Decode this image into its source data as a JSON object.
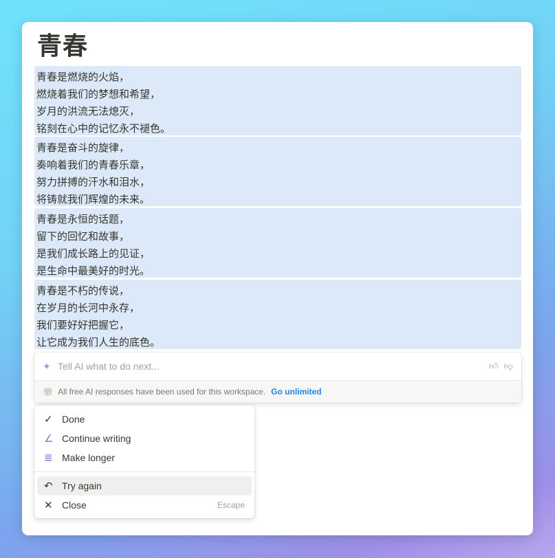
{
  "page": {
    "title": "青春"
  },
  "stanzas": [
    [
      "青春是燃烧的火焰，",
      "燃烧着我们的梦想和希望，",
      "岁月的洪流无法熄灭，",
      "铭刻在心中的记忆永不褪色。"
    ],
    [
      "青春是奋斗的旋律，",
      "奏响着我们的青春乐章，",
      "努力拼搏的汗水和泪水，",
      "将铸就我们辉煌的未来。"
    ],
    [
      "青春是永恒的话题，",
      "留下的回忆和故事，",
      "是我们成长路上的见证，",
      "是生命中最美好的时光。"
    ],
    [
      "青春是不朽的传说，",
      "在岁月的长河中永存，",
      "我们要好好把握它，",
      "让它成为我们人生的底色。"
    ]
  ],
  "ai_bar": {
    "placeholder": "Tell AI what to do next...",
    "notice": "All free AI responses have been used for this workspace.",
    "link": "Go unlimited",
    "link_color": "#2383e2"
  },
  "menu": {
    "items": [
      {
        "label": "Done",
        "icon": "check-icon"
      },
      {
        "label": "Continue writing",
        "icon": "pen-icon"
      },
      {
        "label": "Make longer",
        "icon": "lines-icon"
      },
      {
        "label": "Try again",
        "icon": "undo-icon"
      },
      {
        "label": "Close",
        "icon": "close-icon",
        "shortcut": "Escape"
      }
    ]
  }
}
